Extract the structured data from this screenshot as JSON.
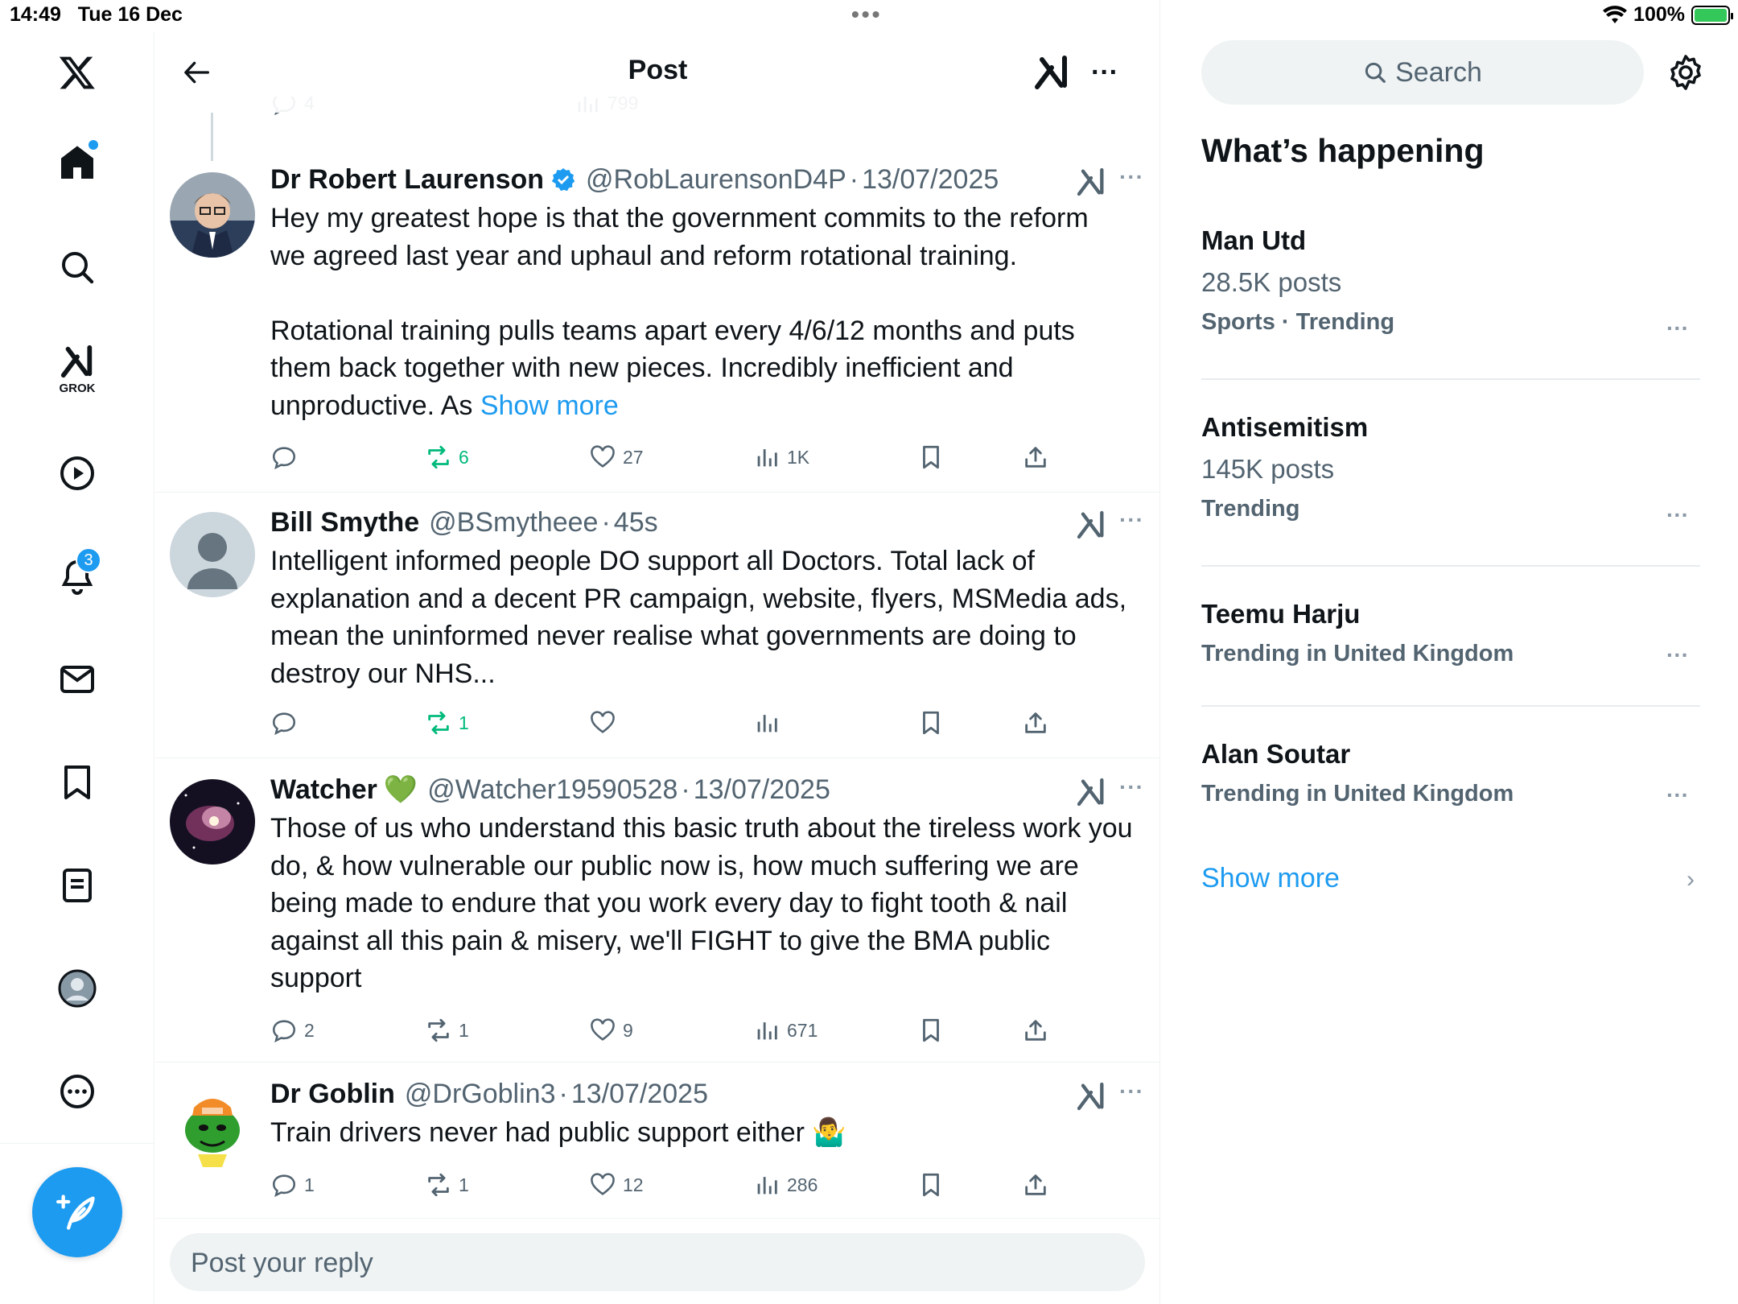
{
  "status": {
    "time": "14:49",
    "date": "Tue 16 Dec",
    "battery": "100%"
  },
  "nav": {
    "grok_label": "GROK",
    "notifications_badge": "3",
    "items": [
      "x-logo-icon",
      "home-icon",
      "search-icon",
      "grok-icon",
      "video-icon",
      "bell-icon",
      "mail-icon",
      "bookmark-icon",
      "lists-icon",
      "profile-icon",
      "more-icon"
    ]
  },
  "header": {
    "title": "Post"
  },
  "prev_post_actions": {
    "replies": "4",
    "views": "799"
  },
  "posts": [
    {
      "name": "Dr Robert Laurenson",
      "verified": true,
      "handle": "@RobLaurensonD4P",
      "sep": "·",
      "date": "13/07/2025",
      "text": "Hey my greatest hope is that the government commits to the reform\nwe agreed last year and uphaul and reform rotational training.\n\nRotational training pulls teams apart every 4/6/12 months and puts\nthem back together with new pieces. Incredibly inefficient and\nunproductive. As ",
      "show_more": "Show more",
      "replies": "",
      "reposts": "6",
      "likes": "27",
      "views": "1K"
    },
    {
      "name": "Bill Smythe",
      "handle": "@BSmytheee",
      "sep": "·",
      "date": "45s",
      "text": "Intelligent informed people DO support all Doctors. Total lack of\nexplanation and a decent PR campaign, website, flyers, MSMedia ads,\nmean the uninformed never realise what governments are doing to\ndestroy our NHS...",
      "replies": "",
      "reposts": "1",
      "likes": "",
      "views": ""
    },
    {
      "name": "Watcher",
      "emoji": "💚",
      "handle": "@Watcher19590528",
      "sep": "·",
      "date": "13/07/2025",
      "text": "Those of us who understand this basic truth about the tireless work you\ndo, & how vulnerable our public now is, how much suffering we are\nbeing made to endure that you work every day to fight tooth & nail\nagainst all this pain & misery, we'll FIGHT to give the BMA public\nsupport",
      "replies": "2",
      "reposts": "1",
      "likes": "9",
      "views": "671"
    },
    {
      "name": "Dr Goblin",
      "handle": "@DrGoblin3",
      "sep": "·",
      "date": "13/07/2025",
      "text": "Train drivers never had public support either 🤷‍♂️",
      "replies": "1",
      "reposts": "1",
      "likes": "12",
      "views": "286"
    }
  ],
  "reply": {
    "placeholder": "Post your reply"
  },
  "sidebar": {
    "search_placeholder": "Search",
    "section_title": "What’s happening",
    "trends": [
      {
        "name": "Man Utd",
        "count": "28.5K posts",
        "meta": "Sports · Trending"
      },
      {
        "name": "Antisemitism",
        "count": "145K posts",
        "meta": "Trending"
      },
      {
        "name": "Teemu Harju",
        "count": "",
        "meta": "Trending in United Kingdom"
      },
      {
        "name": "Alan Soutar",
        "count": "",
        "meta": "Trending in United Kingdom"
      }
    ],
    "show_more": "Show more"
  },
  "colors": {
    "accent": "#1d9bf0",
    "repost_active": "#00ba7c",
    "secondary_text": "#536471"
  }
}
